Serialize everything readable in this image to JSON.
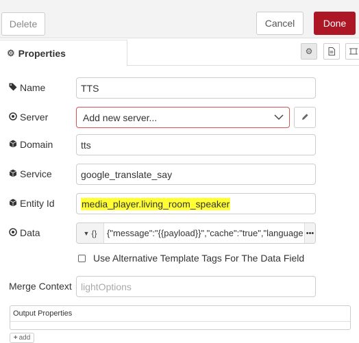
{
  "toolbar": {
    "delete_label": "Delete",
    "cancel_label": "Cancel",
    "done_label": "Done",
    "done_color": "#ad1625"
  },
  "tabs": {
    "properties_label": "Properties"
  },
  "fields": {
    "name": {
      "label": "Name",
      "value": "TTS"
    },
    "server": {
      "label": "Server",
      "value": "Add new server..."
    },
    "domain": {
      "label": "Domain",
      "value": "tts"
    },
    "service": {
      "label": "Service",
      "value": "google_translate_say"
    },
    "entity_id": {
      "label": "Entity Id",
      "value": "media_player.living_room_speaker",
      "highlight_color": "#ffff33"
    },
    "data": {
      "label": "Data",
      "type_label": "{}",
      "value": "{\"message\":\"{{payload}}\",\"cache\":\"true\",\"language"
    },
    "alt_tags": {
      "label": "Use Alternative Template Tags For The Data Field",
      "checked": false
    },
    "merge_context": {
      "label": "Merge Context",
      "placeholder": "lightOptions"
    }
  },
  "output": {
    "title": "Output Properties",
    "add_label": "add"
  },
  "icons": {
    "properties_tab": "gear-icon",
    "name": "tag-icon",
    "server": "dot-circle-icon",
    "domain": "cube-icon",
    "service": "cube-icon",
    "entity_id": "cube-icon",
    "data": "dot-circle-icon"
  }
}
